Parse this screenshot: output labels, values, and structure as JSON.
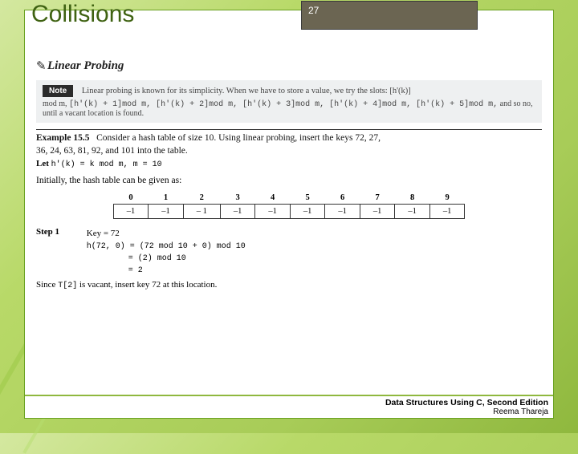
{
  "page_number": "27",
  "title": "Collisions",
  "subtitle": "Linear Probing",
  "note": {
    "tag": "Note",
    "line1": "Linear probing is known for its simplicity. When we have to store a value, we try the slots: [h'(k)]",
    "line2_prefix": "mod m, ",
    "terms": "[h'(k) + 1]mod m, [h'(k) + 2]mod m, [h'(k) + 3]mod m, [h'(k) + 4]mod m, [h'(k) + 5]mod m,",
    "line2_suffix": " and so no, until a vacant location is found."
  },
  "example": {
    "label": "Example 15.5",
    "text1": "Consider a hash table of size 10. Using linear probing, insert the keys 72, 27,",
    "text2": "36, 24, 63, 81, 92, and 101 into the table."
  },
  "let": {
    "prefix": "Let ",
    "formula": "h'(k) = k mod m, m = 10"
  },
  "initial_text": "Initially, the hash table can be given as:",
  "hash_table": {
    "headers": [
      "0",
      "1",
      "2",
      "3",
      "4",
      "5",
      "6",
      "7",
      "8",
      "9"
    ],
    "row": [
      "–1",
      "–1",
      "– 1",
      "–1",
      "–1",
      "–1",
      "–1",
      "–1",
      "–1",
      "–1"
    ]
  },
  "step": {
    "label": "Step 1",
    "key_line": "Key = 72",
    "lines": [
      "h(72, 0) = (72 mod 10 + 0) mod 10",
      "= (2) mod 10",
      "= 2"
    ]
  },
  "since": {
    "prefix": "Since ",
    "code": "T[2]",
    "suffix": " is vacant, insert key 72 at this location."
  },
  "footer": {
    "line1": "Data Structures Using C, Second Edition",
    "line2": "Reema Thareja"
  }
}
